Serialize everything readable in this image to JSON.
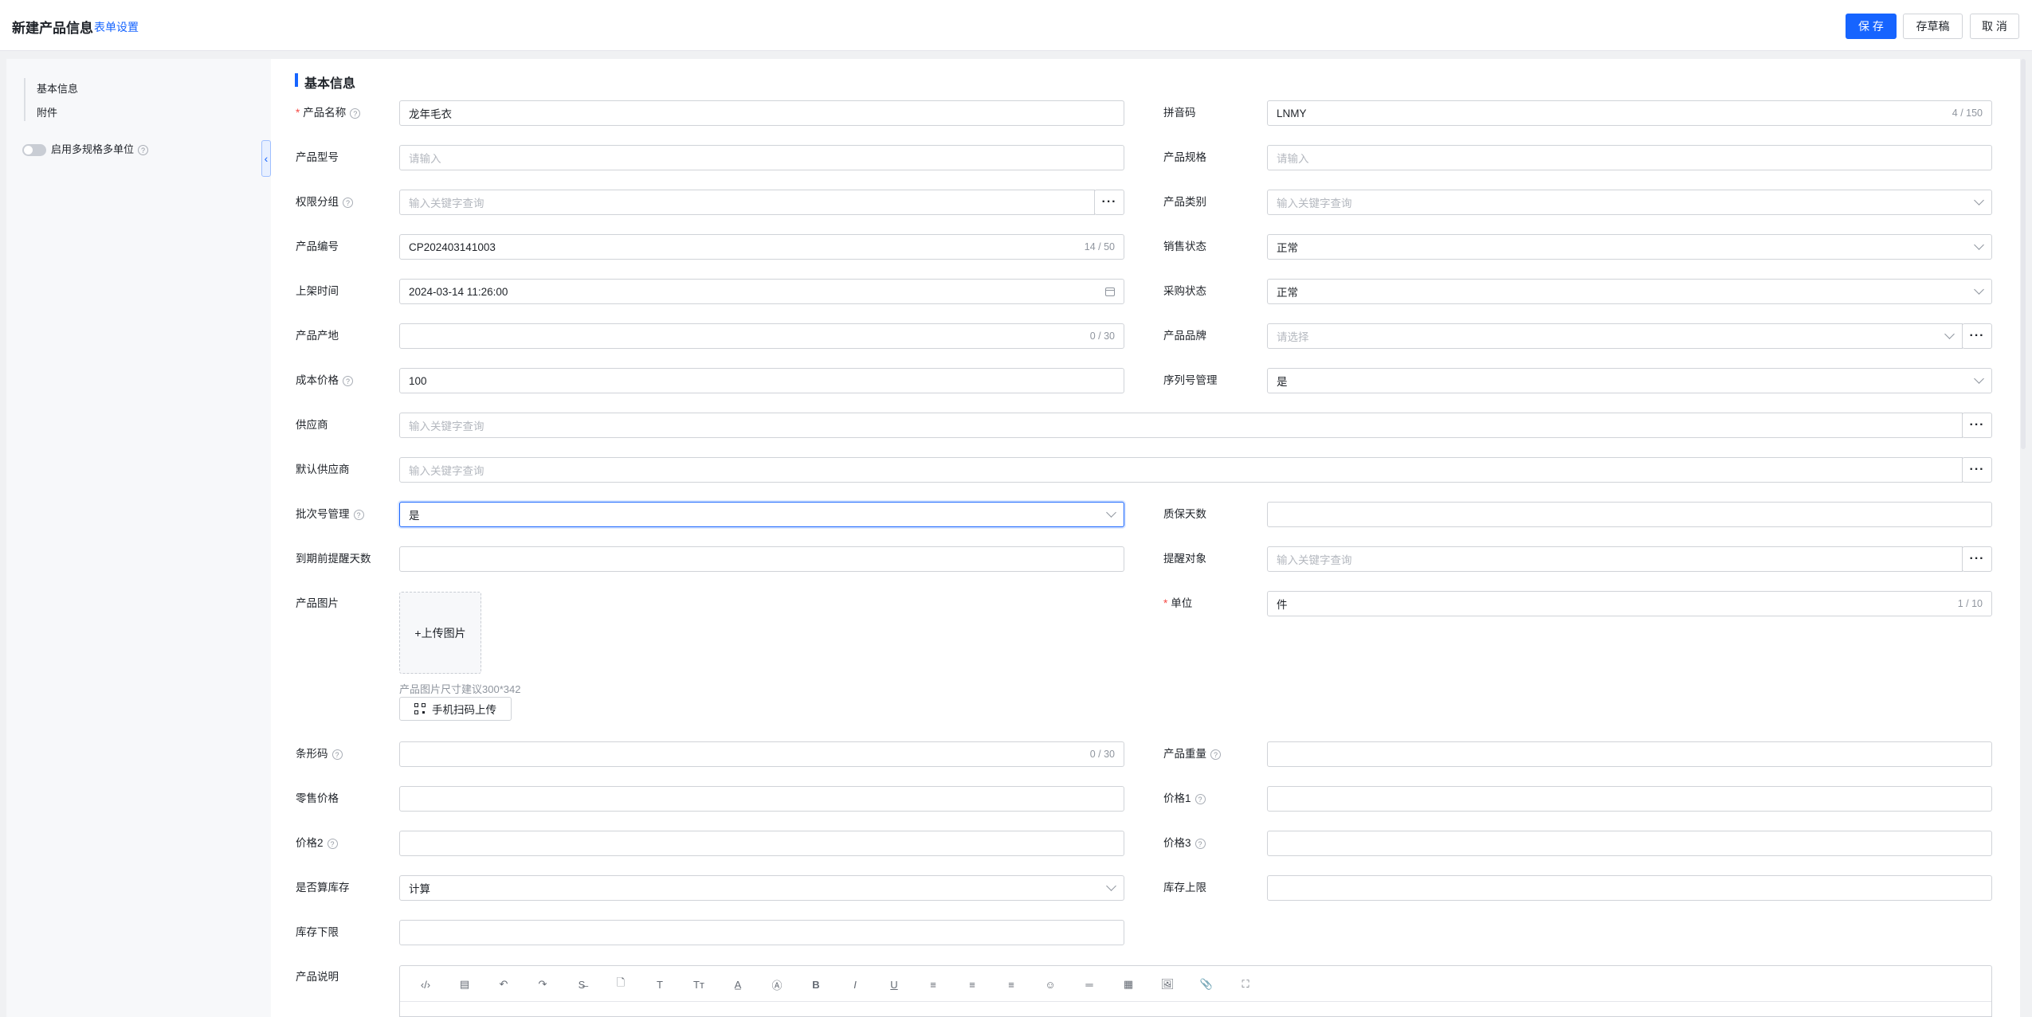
{
  "header": {
    "title": "新建产品信息",
    "form_setting": "表单设置",
    "save": "保 存",
    "save_draft": "存草稿",
    "cancel": "取 消"
  },
  "sidebar": {
    "items": [
      "基本信息",
      "附件"
    ],
    "toggle_label": "启用多规格多单位",
    "collapse": "‹"
  },
  "section": {
    "title": "基本信息"
  },
  "fields": {
    "product_name": {
      "label": "产品名称",
      "value": "龙年毛衣"
    },
    "pinyin": {
      "label": "拼音码",
      "value": "LNMY",
      "count": "4 / 150"
    },
    "model": {
      "label": "产品型号",
      "placeholder": "请输入"
    },
    "spec": {
      "label": "产品规格",
      "placeholder": "请输入"
    },
    "perm_group": {
      "label": "权限分组",
      "placeholder": "输入关键字查询"
    },
    "category": {
      "label": "产品类别",
      "placeholder": "输入关键字查询"
    },
    "code": {
      "label": "产品编号",
      "value": "CP202403141003",
      "count": "14 / 50"
    },
    "sales_status": {
      "label": "销售状态",
      "value": "正常"
    },
    "listing_time": {
      "label": "上架时间",
      "value": "2024-03-14 11:26:00"
    },
    "purchase_status": {
      "label": "采购状态",
      "value": "正常"
    },
    "origin": {
      "label": "产品产地",
      "count": "0 / 30"
    },
    "brand": {
      "label": "产品品牌",
      "placeholder": "请选择"
    },
    "cost_price": {
      "label": "成本价格",
      "value": "100"
    },
    "serial_mgmt": {
      "label": "序列号管理",
      "value": "是"
    },
    "supplier": {
      "label": "供应商",
      "placeholder": "输入关键字查询"
    },
    "default_supplier": {
      "label": "默认供应商",
      "placeholder": "输入关键字查询"
    },
    "batch_mgmt": {
      "label": "批次号管理",
      "value": "是"
    },
    "warranty_days": {
      "label": "质保天数"
    },
    "expiry_remind_days": {
      "label": "到期前提醒天数"
    },
    "remind_target": {
      "label": "提醒对象",
      "placeholder": "输入关键字查询"
    },
    "image": {
      "label": "产品图片",
      "upload": "+上传图片",
      "hint": "产品图片尺寸建议300*342",
      "qr_upload": "手机扫码上传"
    },
    "unit": {
      "label": "单位",
      "value": "件",
      "count": "1 / 10"
    },
    "barcode": {
      "label": "条形码",
      "count": "0 / 30"
    },
    "weight": {
      "label": "产品重量"
    },
    "retail_price": {
      "label": "零售价格"
    },
    "price1": {
      "label": "价格1"
    },
    "price2": {
      "label": "价格2"
    },
    "price3": {
      "label": "价格3"
    },
    "count_stock": {
      "label": "是否算库存",
      "value": "计算"
    },
    "stock_max": {
      "label": "库存上限"
    },
    "stock_min": {
      "label": "库存下限"
    },
    "description": {
      "label": "产品说明"
    }
  },
  "editor_toolbar": [
    "‹/›",
    "▤",
    "↶",
    "↷",
    "S̶",
    "🗋",
    "T",
    "Tт",
    "A̲",
    "Ⓐ",
    "B",
    "I",
    "U",
    "≡",
    "≡",
    "≡",
    "☺",
    "═",
    "▦",
    "🖼",
    "📎",
    "⛶"
  ],
  "icons": {
    "help": "?",
    "more": "···"
  }
}
